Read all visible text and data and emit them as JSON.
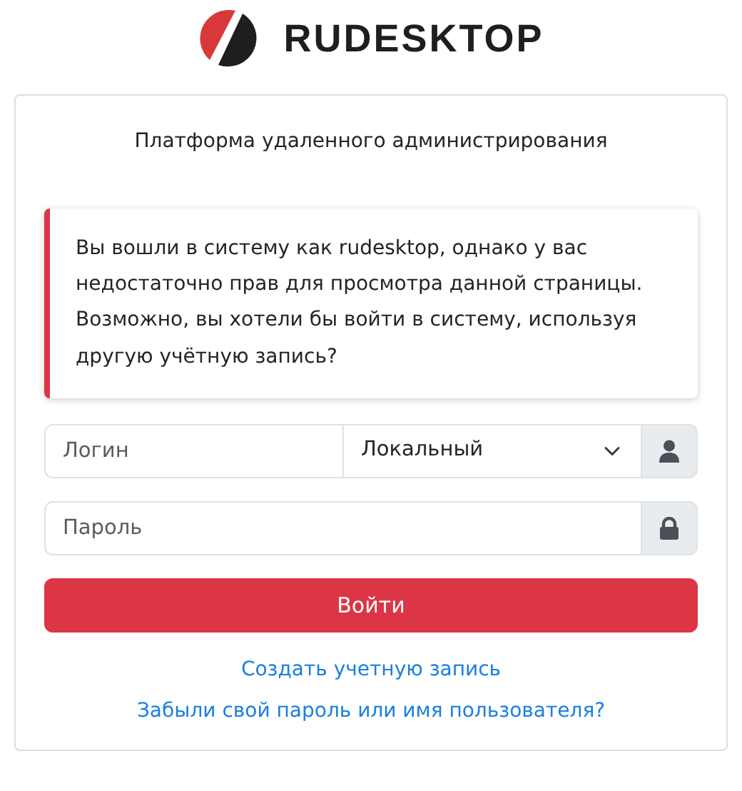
{
  "logo": {
    "text": "RUDESKTOP"
  },
  "subtitle": "Платформа удаленного администрирования",
  "alert": "Вы вошли в систему как rudesktop, однако у вас недостаточно прав для просмотра данной страницы. Возможно, вы хотели бы войти в систему, используя другую учётную запись?",
  "login": {
    "placeholder": "Логин",
    "realm": "Локальный"
  },
  "password": {
    "placeholder": "Пароль"
  },
  "submit": "Войти",
  "links": [
    "Создать учетную запись",
    "Забыли свой пароль или имя пользователя?"
  ]
}
